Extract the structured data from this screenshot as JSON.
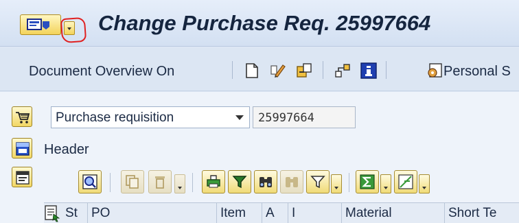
{
  "window": {
    "title": "Change Purchase Req. 25997664"
  },
  "toolbar": {
    "document_overview_label": "Document Overview On",
    "personal_label": "Personal S",
    "icons": [
      "new-document-icon",
      "edit-pencil-icon",
      "copy-structure-icon",
      "org-hierarchy-icon",
      "info-icon",
      "personal-settings-icon"
    ]
  },
  "form": {
    "doc_type_value": "Purchase requisition",
    "doc_number_value": "25997664",
    "header_label": "Header"
  },
  "table": {
    "columns": [
      "St",
      "PO",
      "Item",
      "A",
      "I",
      "Material",
      "Short Te"
    ]
  },
  "colors": {
    "accent_yellow": "#f3d35a",
    "annotation_red": "#e02020",
    "title_text": "#15253f"
  }
}
